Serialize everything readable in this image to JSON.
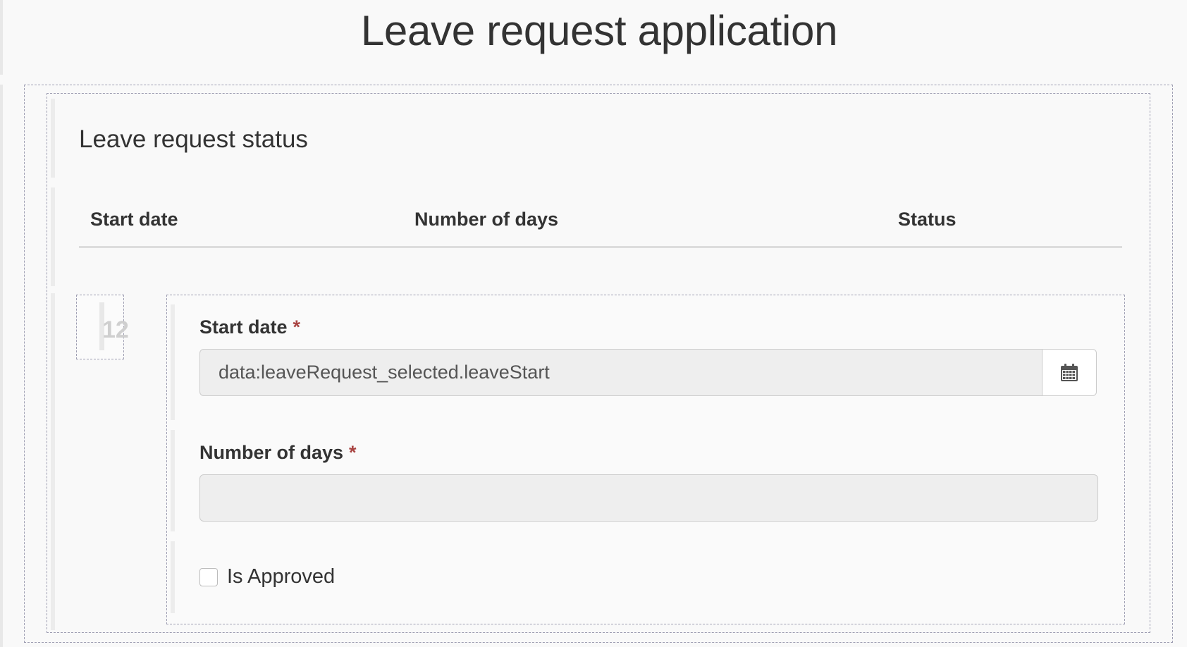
{
  "app": {
    "title": "Leave request application"
  },
  "status_section": {
    "title": "Leave request status",
    "table": {
      "columns": [
        "Start date",
        "Number of days",
        "Status"
      ],
      "rows": []
    },
    "row_number": "12"
  },
  "form": {
    "start_date": {
      "label": "Start date",
      "required_mark": "*",
      "value": "data:leaveRequest_selected.leaveStart",
      "button_icon": "calendar-icon"
    },
    "number_of_days": {
      "label": "Number of days",
      "required_mark": "*",
      "value": ""
    },
    "is_approved": {
      "label": "Is Approved",
      "checked": false
    }
  },
  "colors": {
    "required": "#a94442",
    "panel_border": "#9e9eb2",
    "input_bg": "#eeeeee"
  }
}
